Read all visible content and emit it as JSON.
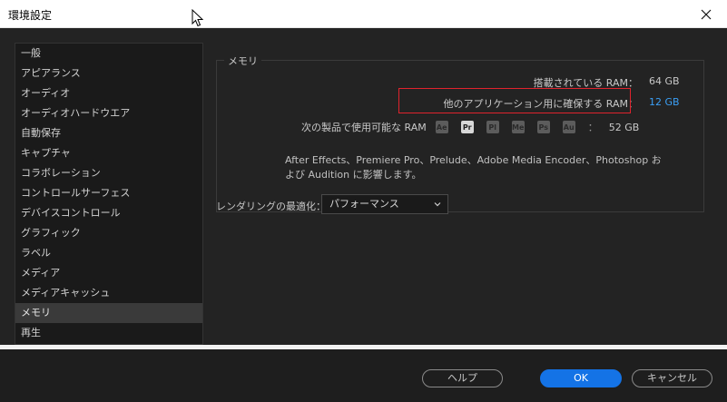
{
  "window": {
    "title": "環境設定",
    "close_icon": "close-icon"
  },
  "sidebar": {
    "items": [
      {
        "label": "一般"
      },
      {
        "label": "アピアランス"
      },
      {
        "label": "オーディオ"
      },
      {
        "label": "オーディオハードウエア"
      },
      {
        "label": "自動保存"
      },
      {
        "label": "キャプチャ"
      },
      {
        "label": "コラボレーション"
      },
      {
        "label": "コントロールサーフェス"
      },
      {
        "label": "デバイスコントロール"
      },
      {
        "label": "グラフィック"
      },
      {
        "label": "ラベル"
      },
      {
        "label": "メディア"
      },
      {
        "label": "メディアキャッシュ"
      },
      {
        "label": "メモリ",
        "selected": true
      },
      {
        "label": "再生"
      }
    ]
  },
  "memory": {
    "group_label": "メモリ",
    "installed_label": "搭載されている RAM：",
    "installed_value": "64 GB",
    "reserved_label": "他のアプリケーション用に確保する RAM：",
    "reserved_value": "12 GB",
    "available_label": "次の製品で使用可能な RAM",
    "apps": [
      "Ae",
      "Pr",
      "Pl",
      "Me",
      "Ps",
      "Au"
    ],
    "active_app": "Pr",
    "available_sep": "：",
    "available_value": "52 GB",
    "note": "After Effects、Premiere Pro、Prelude、Adobe Media Encoder、Photoshop および Audition に影響します。",
    "highlight_color": "#e0232d",
    "value_color": "#3b9ff5"
  },
  "rendering": {
    "label": "レンダリングの最適化：",
    "value": "パフォーマンス"
  },
  "footer": {
    "help_label": "ヘルプ",
    "ok_label": "OK",
    "cancel_label": "キャンセル",
    "ok_color": "#1473e6"
  }
}
